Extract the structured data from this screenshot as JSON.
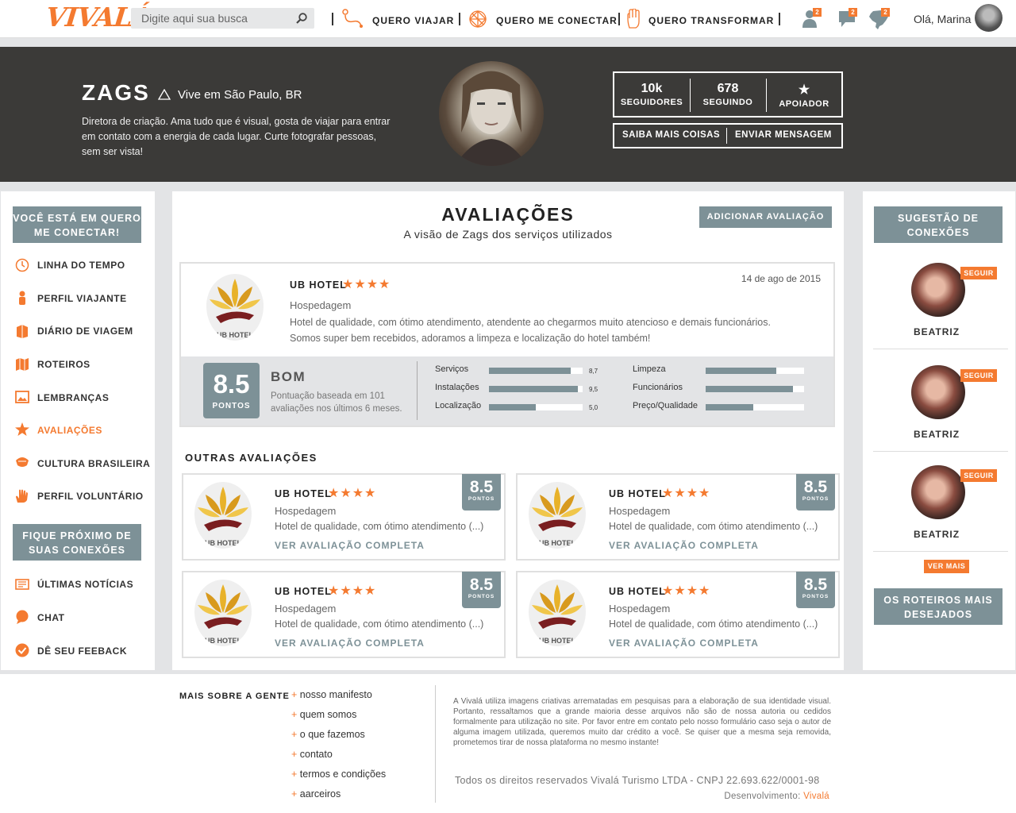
{
  "nav": {
    "logo": "VIVALÁ",
    "search_placeholder": "Digite aqui sua busca",
    "items": [
      {
        "label": "QUERO VIAJAR"
      },
      {
        "label": "QUERO ME CONECTAR"
      },
      {
        "label": "QUERO TRANSFORMAR"
      }
    ],
    "badges": [
      "2",
      "2",
      "2"
    ],
    "greeting": "Olá, Marina"
  },
  "profile": {
    "name": "ZAGS",
    "lives": "Vive em São Paulo, BR",
    "bio": "Diretora de criação. Ama tudo que é visual, gosta de viajar para entrar em contato com a energia de cada lugar. Curte fotografar pessoas, sem ser vista!",
    "stats": [
      {
        "value": "10k",
        "label": "SEGUIDORES"
      },
      {
        "value": "678",
        "label": "SEGUINDO"
      },
      {
        "value": "★",
        "label": "APOIADOR"
      }
    ],
    "actions": [
      "SAIBA MAIS COISAS",
      "ENVIAR MENSAGEM"
    ]
  },
  "left": {
    "section1": "VOCÊ ESTÁ EM QUERO ME CONECTAR!",
    "items": [
      {
        "label": "LINHA DO TEMPO",
        "icon": "clock-icon"
      },
      {
        "label": "PERFIL VIAJANTE",
        "icon": "person-icon"
      },
      {
        "label": "DIÁRIO DE VIAGEM",
        "icon": "book-icon"
      },
      {
        "label": "ROTEIROS",
        "icon": "map-icon"
      },
      {
        "label": "LEMBRANÇAS",
        "icon": "image-icon"
      },
      {
        "label": "AVALIAÇÕES",
        "icon": "star-icon"
      },
      {
        "label": "CULTURA BRASILEIRA",
        "icon": "culture-icon"
      },
      {
        "label": "PERFIL VOLUNTÁRIO",
        "icon": "hand-icon"
      }
    ],
    "section2": "FIQUE PRÓXIMO DE SUAS CONEXÕES",
    "items2": [
      {
        "label": "ÚLTIMAS NOTÍCIAS",
        "icon": "news-icon"
      },
      {
        "label": "CHAT",
        "icon": "chat-icon"
      },
      {
        "label": "DÊ SEU FEEBACK",
        "icon": "check-icon"
      }
    ]
  },
  "main": {
    "title": "AVALIAÇÕES",
    "subtitle": "A visão de Zags dos serviços utilizados",
    "add_button": "ADICIONAR AVALIAÇÃO",
    "featured": {
      "hotel": "UB HOTEL",
      "logo_text": "UB HOTEL",
      "stars": "★★★★",
      "date": "14 de ago de 2015",
      "category": "Hospedagem",
      "review": "Hotel de qualidade, com ótimo atendimento, atendente ao chegarmos muito atencioso e demais funcionários. Somos super bem recebidos, adoramos a limpeza e localização do hotel também!",
      "score": "8.5",
      "score_label": "PONTOS",
      "rating_word": "BOM",
      "rating_desc": "Pontuação baseada em 101 avaliações nos últimos 6 meses.",
      "bars_left": [
        {
          "label": "Serviços",
          "value": 8.7,
          "text": "8,7"
        },
        {
          "label": "Instalações",
          "value": 9.5,
          "text": "9,5"
        },
        {
          "label": "Localização",
          "value": 5.0,
          "text": "5,0"
        }
      ],
      "bars_right": [
        {
          "label": "Limpeza",
          "value": 7.2
        },
        {
          "label": "Funcionários",
          "value": 8.9
        },
        {
          "label": "Preço/Qualidade",
          "value": 4.8
        }
      ]
    },
    "others_title": "OUTRAS AVALIAÇÕES",
    "cards": [
      {
        "hotel": "UB HOTEL",
        "stars": "★★★★",
        "category": "Hospedagem",
        "desc": "Hotel de qualidade, com ótimo atendimento (...)",
        "link": "VER AVALIAÇÃO COMPLETA",
        "score": "8.5",
        "score_label": "PONTOS"
      },
      {
        "hotel": "UB HOTEL",
        "stars": "★★★★",
        "category": "Hospedagem",
        "desc": "Hotel de qualidade, com ótimo atendimento (...)",
        "link": "VER AVALIAÇÃO COMPLETA",
        "score": "8.5",
        "score_label": "PONTOS"
      },
      {
        "hotel": "UB HOTEL",
        "stars": "★★★★",
        "category": "Hospedagem",
        "desc": "Hotel de qualidade, com ótimo atendimento (...)",
        "link": "VER AVALIAÇÃO COMPLETA",
        "score": "8.5",
        "score_label": "PONTOS"
      },
      {
        "hotel": "UB HOTEL",
        "stars": "★★★★",
        "category": "Hospedagem",
        "desc": "Hotel de qualidade, com ótimo atendimento (...)",
        "link": "VER AVALIAÇÃO COMPLETA",
        "score": "8.5",
        "score_label": "PONTOS"
      }
    ]
  },
  "right": {
    "title": "SUGESTÃO DE CONEXÕES",
    "suggestions": [
      {
        "name": "BEATRIZ",
        "follow": "SEGUIR"
      },
      {
        "name": "BEATRIZ",
        "follow": "SEGUIR"
      },
      {
        "name": "BEATRIZ",
        "follow": "SEGUIR"
      }
    ],
    "more": "VER MAIS",
    "routes": "OS ROTEIROS MAIS DESEJADOS"
  },
  "footer": {
    "more_title": "MAIS SOBRE A GENTE",
    "links": [
      "nosso manifesto",
      "quem somos",
      "o que fazemos",
      "contato",
      "termos e condições",
      "aarceiros"
    ],
    "note": "A Vivalá utiliza imagens criativas arrematadas em pesquisas para a elaboração de sua identidade visual. Portanto, ressaltamos que a grande maioria desse arquivos não são de nossa autoria ou cedidos formalmente para utilização no site. Por favor entre em contato pelo nosso formulário caso seja o autor de alguma imagem utilizada, queremos muito dar crédito a você. Se quiser que a mesma seja removida, prometemos tirar de nossa plataforma no mesmo instante!",
    "copyright": "Todos os direitos reservados Vivalá Turismo LTDA   -   CNPJ 22.693.622/0001-98",
    "dev_label": "Desenvolvimento:",
    "dev_name": "Vivalá"
  },
  "colors": {
    "accent": "#f47a30",
    "slate": "#7d9197",
    "dark": "#3b3a38"
  }
}
